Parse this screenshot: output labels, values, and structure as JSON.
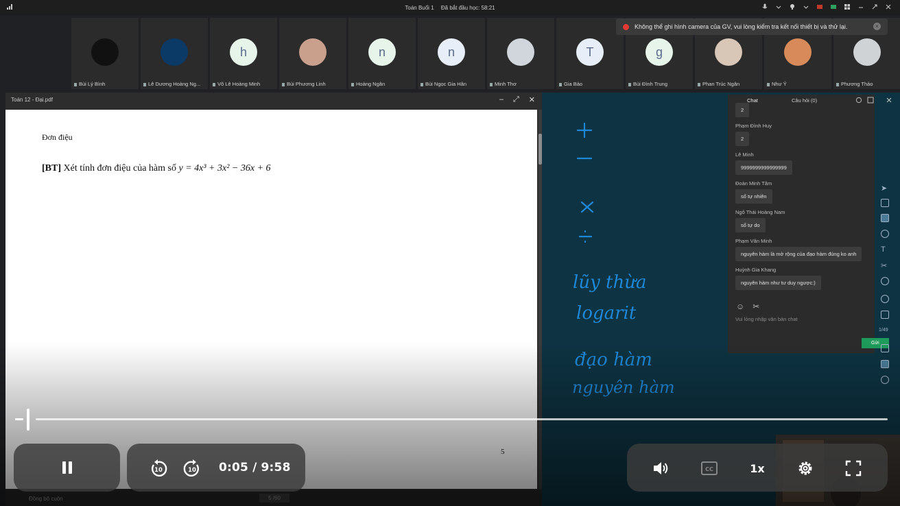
{
  "top_bar": {
    "meeting_title": "Toán Buổi 1",
    "status": "Đã bắt đầu học: 58:21"
  },
  "participants": [
    {
      "name": "Bùi Lý Bình",
      "initial": ""
    },
    {
      "name": "Lê Dương Hoàng Ng...",
      "initial": ""
    },
    {
      "name": "Võ Lê Hoàng Minh",
      "initial": "h"
    },
    {
      "name": "Bùi Phương Linh",
      "initial": ""
    },
    {
      "name": "Hoàng Ngân",
      "initial": "n"
    },
    {
      "name": "Bùi Ngọc Gia Hân",
      "initial": "n"
    },
    {
      "name": "Minh Thơ",
      "initial": ""
    },
    {
      "name": "Gia Bảo",
      "initial": "T"
    },
    {
      "name": "Bùi Đình Trung",
      "initial": "g"
    },
    {
      "name": "Phan Trúc Ngân",
      "initial": ""
    },
    {
      "name": "Như Ý",
      "initial": ""
    },
    {
      "name": "Phương Thảo",
      "initial": ""
    }
  ],
  "toast": {
    "message": "Không thể ghi hình camera của GV, vui lòng kiểm tra kết nối thiết bị và thử lại.",
    "close_icon": "×"
  },
  "pdf": {
    "window_title": "Toán 12 - Đại.pdf",
    "minimize": "–",
    "expand": "⤢",
    "close": "✕",
    "heading": "Đơn điệu",
    "exercise_tag": "[BT]",
    "exercise_text": "Xét tính đơn điệu của hàm số",
    "formula": "y = 4x³ + 3x² − 36x + 6",
    "page_number": "5",
    "footer_sync": "Đồng bộ cuộn",
    "footer_page": "5 /60"
  },
  "chat": {
    "tab_chat": "Chat",
    "tab_questions": "Câu hỏi (0)",
    "messages": [
      {
        "sender": "",
        "text": "2"
      },
      {
        "sender": "Phạm Đình Huy",
        "text": "2"
      },
      {
        "sender": "Lê Minh",
        "text": "9999999999999999"
      },
      {
        "sender": "Đoàn Minh Tâm",
        "text": "số tự nhiên"
      },
      {
        "sender": "Ngô Thái Hoàng Nam",
        "text": "số tự do"
      },
      {
        "sender": "Phạm Văn Minh",
        "text": "nguyên hàm là mở rộng của đạo hàm đúng ko anh"
      },
      {
        "sender": "Huỳnh Gia Khang",
        "text": "nguyên hàm như tư duy ngược:)"
      }
    ],
    "input_placeholder": "Vui lòng nhập văn bản chat",
    "send_label": "Gửi",
    "counter": "1/49"
  },
  "board_notes": [
    "+",
    "−",
    "×",
    "÷",
    "lũy thừa",
    "logarit",
    "đạo hàm",
    "nguyên hàm"
  ],
  "player": {
    "progress_fraction": 0.0084,
    "current_time": "0:05",
    "separator": "/",
    "duration": "9:58",
    "speed": "1x",
    "rewind_label": "10",
    "forward_label": "10"
  },
  "colors": {
    "board": "#0e3342",
    "ink": "#1e88d8",
    "send": "#1e9a5a",
    "toast_error": "#e53935"
  }
}
